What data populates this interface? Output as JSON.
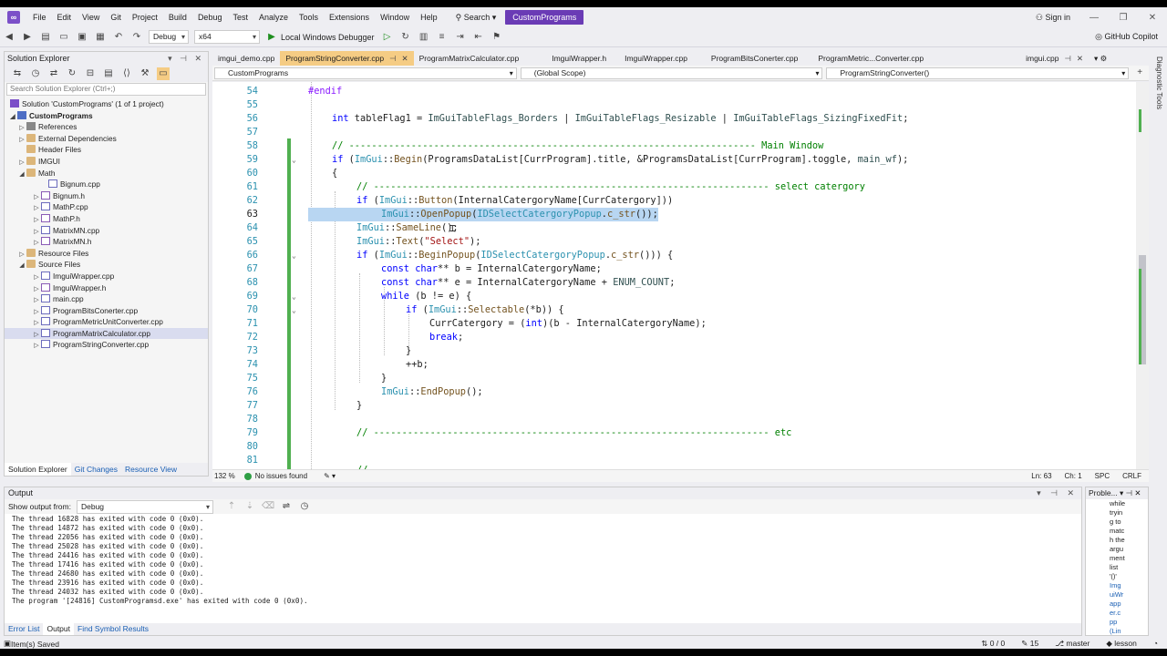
{
  "menubar": {
    "items": [
      "File",
      "Edit",
      "View",
      "Git",
      "Project",
      "Build",
      "Debug",
      "Test",
      "Analyze",
      "Tools",
      "Extensions",
      "Window",
      "Help"
    ],
    "search": "Search",
    "solution_title": "CustomPrograms",
    "sign_in": "Sign in"
  },
  "toolbar": {
    "config": "Debug",
    "platform": "x64",
    "run_label": "Local Windows Debugger",
    "copilot": "GitHub Copilot"
  },
  "solution_explorer": {
    "title": "Solution Explorer",
    "search_placeholder": "Search Solution Explorer (Ctrl+;)",
    "items": [
      {
        "label": "Solution 'CustomPrograms' (1 of 1 project)",
        "icon": "solution-icon"
      },
      {
        "label": "CustomPrograms",
        "icon": "project-icon"
      },
      {
        "label": "References",
        "icon": "references-icon"
      },
      {
        "label": "External Dependencies",
        "icon": "folder-icon"
      },
      {
        "label": "Header Files",
        "icon": "folder-icon"
      },
      {
        "label": "IMGUI",
        "icon": "folder-icon"
      },
      {
        "label": "Math",
        "icon": "folder-icon"
      },
      {
        "label": "Bignum.cpp",
        "icon": "cpp-file-icon"
      },
      {
        "label": "Bignum.h",
        "icon": "header-file-icon"
      },
      {
        "label": "MathP.cpp",
        "icon": "cpp-file-icon"
      },
      {
        "label": "MathP.h",
        "icon": "header-file-icon"
      },
      {
        "label": "MatrixMN.cpp",
        "icon": "cpp-file-icon"
      },
      {
        "label": "MatrixMN.h",
        "icon": "header-file-icon"
      },
      {
        "label": "Resource Files",
        "icon": "folder-icon"
      },
      {
        "label": "Source Files",
        "icon": "folder-icon"
      },
      {
        "label": "ImguiWrapper.cpp",
        "icon": "cpp-file-icon"
      },
      {
        "label": "ImguiWrapper.h",
        "icon": "header-file-icon"
      },
      {
        "label": "main.cpp",
        "icon": "cpp-file-icon"
      },
      {
        "label": "ProgramBitsConerter.cpp",
        "icon": "cpp-file-icon"
      },
      {
        "label": "ProgramMetricUnitConverter.cpp",
        "icon": "cpp-file-icon"
      },
      {
        "label": "ProgramMatrixCalculator.cpp",
        "icon": "cpp-file-icon"
      },
      {
        "label": "ProgramStringConverter.cpp",
        "icon": "cpp-file-icon"
      }
    ],
    "tabs": [
      "Solution Explorer",
      "Git Changes",
      "Resource View"
    ]
  },
  "editor": {
    "tabs": [
      "imgui_demo.cpp",
      "ProgramStringConverter.cpp",
      "ProgramMatrixCalculator.cpp",
      "ImguiWrapper.h",
      "ImguiWrapper.cpp",
      "ProgramBitsConerter.cpp",
      "ProgramMetric...Converter.cpp",
      "imgui.cpp"
    ],
    "nav_project": "CustomPrograms",
    "nav_scope": "(Global Scope)",
    "nav_member": "ProgramStringConverter()",
    "line_numbers": [
      "54",
      "55",
      "56",
      "57",
      "58",
      "59",
      "60",
      "61",
      "62",
      "63",
      "64",
      "65",
      "66",
      "67",
      "68",
      "69",
      "70",
      "71",
      "72",
      "73",
      "74",
      "75",
      "76",
      "77",
      "78",
      "79",
      "80",
      "81"
    ],
    "zoom": "132 %",
    "issues": "No issues found",
    "ln": "Ln: 63",
    "ch": "Ch: 1",
    "spc": "SPC",
    "crlf": "CRLF"
  },
  "code_tokens": {
    "l54_endif": "#endif",
    "l56_int": "int",
    "l56_var": " tableFlag1 = ",
    "l56_e1": "ImGuiTableFlags_Borders",
    "l56_or1": " | ",
    "l56_e2": "ImGuiTableFlags_Resizable",
    "l56_or2": " | ",
    "l56_e3": "ImGuiTableFlags_SizingFixedFit",
    "l56_end": ";",
    "l58_comment": "// ------------------------------------------------------------------------ Main Window",
    "l59_if": "if",
    "l59_a": " (",
    "l59_ns": "ImGui",
    "l59_sep": "::",
    "l59_fn": "Begin",
    "l59_b": "(ProgramsDataList[CurrProgram].title, &ProgramsDataList[CurrProgram].toggle, ",
    "l59_mwf": "main_wf",
    "l59_c": ");",
    "l60": "{",
    "l61_comment": "// ---------------------------------------------------------------------- select catergory",
    "l62_if": "if",
    "l62_a": " (",
    "l62_ns": "ImGui",
    "l62_sep": "::",
    "l62_fn": "Button",
    "l62_b": "(InternalCatergoryName[CurrCatergory]))",
    "l63_ns": "ImGui",
    "l63_sep": "::",
    "l63_fn": "OpenPopup",
    "l63_a": "(",
    "l63_id": "IDSelectCatergoryPopup",
    "l63_b": ".",
    "l63_cs": "c_str",
    "l63_c": "());",
    "l64_ns": "ImGui",
    "l64_sep": "::",
    "l64_fn": "SameLine",
    "l64_a": "();",
    "l65_ns": "ImGui",
    "l65_sep": "::",
    "l65_fn": "Text",
    "l65_a": "(",
    "l65_str": "\"Select\"",
    "l65_b": ");",
    "l66_if": "if",
    "l66_a": " (",
    "l66_ns": "ImGui",
    "l66_sep": "::",
    "l66_fn": "BeginPopup",
    "l66_b": "(",
    "l66_id": "IDSelectCatergoryPopup",
    "l66_c": ".",
    "l66_cs": "c_str",
    "l66_d": "())) {",
    "l67_const": "const",
    "l67_char": " char",
    "l67_a": "** b = InternalCatergoryName;",
    "l68_const": "const",
    "l68_char": " char",
    "l68_a": "** e = InternalCatergoryName + ",
    "l68_enum": "ENUM_COUNT",
    "l68_b": ";",
    "l69_while": "while",
    "l69_a": " (b != e) {",
    "l70_if": "if",
    "l70_a": " (",
    "l70_ns": "ImGui",
    "l70_sep": "::",
    "l70_fn": "Selectable",
    "l70_b": "(*b)) {",
    "l71_a": "CurrCatergory = (",
    "l71_int": "int",
    "l71_b": ")(b - InternalCatergoryName);",
    "l72_break": "break",
    "l72_a": ";",
    "l73": "}",
    "l74": "++b;",
    "l75": "}",
    "l76_ns": "ImGui",
    "l76_sep": "::",
    "l76_fn": "EndPopup",
    "l76_a": "();",
    "l77": "}",
    "l79_comment": "// ---------------------------------------------------------------------- etc",
    "l81_comment": "//"
  },
  "output": {
    "title": "Output",
    "show_from_label": "Show output from:",
    "show_from_value": "Debug",
    "lines": [
      "The thread 16828 has exited with code 0 (0x0).",
      "The thread 14872 has exited with code 0 (0x0).",
      "The thread 22056 has exited with code 0 (0x0).",
      "The thread 25028 has exited with code 0 (0x0).",
      "The thread 24416 has exited with code 0 (0x0).",
      "The thread 17416 has exited with code 0 (0x0).",
      "The thread 24680 has exited with code 0 (0x0).",
      "The thread 23916 has exited with code 0 (0x0).",
      "The thread 24032 has exited with code 0 (0x0).",
      "The program '[24816] CustomProgramsd.exe' has exited with code 0 (0x0)."
    ],
    "tabs": [
      "Error List",
      "Output",
      "Find Symbol Results"
    ]
  },
  "problems": {
    "title": "Proble...",
    "text_lines": [
      "while",
      "tryin",
      "g to",
      "matc",
      "h the",
      "argu",
      "ment",
      "list",
      "'()'"
    ],
    "link_lines": [
      "Img",
      "uiWr",
      "app",
      "er.c",
      "pp",
      "(Lin"
    ]
  },
  "statusbar": {
    "left": "Item(s) Saved",
    "errors": "0 / 0",
    "edits": "15",
    "branch": "master",
    "repo": "lesson"
  },
  "diagnostic_tools": "Diagnostic Tools"
}
